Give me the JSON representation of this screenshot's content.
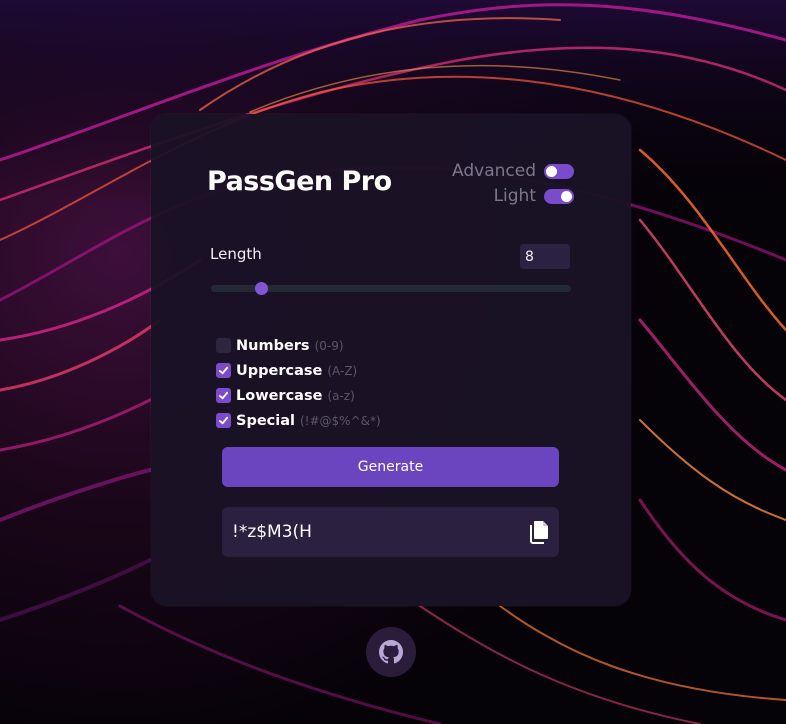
{
  "app": {
    "title": "PassGen Pro"
  },
  "toggles": {
    "advanced": {
      "label": "Advanced",
      "on": false
    },
    "light": {
      "label": "Light",
      "on": true
    }
  },
  "length": {
    "label": "Length",
    "value": "8",
    "slider_fraction": 0.14
  },
  "options": [
    {
      "label": "Numbers",
      "hint": "(0-9)",
      "checked": false
    },
    {
      "label": "Uppercase",
      "hint": "(A-Z)",
      "checked": true
    },
    {
      "label": "Lowercase",
      "hint": "(a-z)",
      "checked": true
    },
    {
      "label": "Special",
      "hint": "(!#@$%^&*)",
      "checked": true
    }
  ],
  "generate_label": "Generate",
  "output": {
    "password": "!*z$M3(H"
  },
  "icons": {
    "copy": "copy-icon",
    "github": "github-icon"
  },
  "colors": {
    "accent": "#7a4ccc",
    "button": "#6b45c0",
    "card": "#1a1226"
  }
}
